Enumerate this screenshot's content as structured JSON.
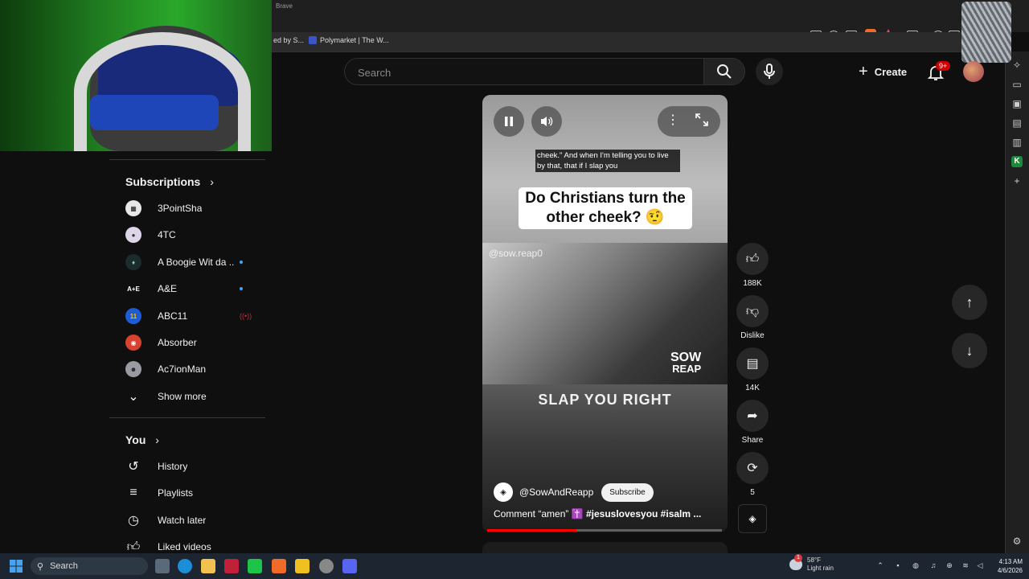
{
  "browser": {
    "app_name": "Brave",
    "bookmarks": [
      "ed by S...",
      "Polymarket | The W..."
    ]
  },
  "sidebar": {
    "subscriptions_title": "Subscriptions",
    "subscriptions": [
      {
        "name": "3PointSha",
        "dot": false
      },
      {
        "name": "4TC",
        "dot": false
      },
      {
        "name": "A Boogie Wit da ...",
        "dot": true
      },
      {
        "name": "A&E",
        "dot": true
      },
      {
        "name": "ABC11",
        "dot": false,
        "live": true
      },
      {
        "name": "Absorber",
        "dot": false
      },
      {
        "name": "Ac7ionMan",
        "dot": false
      }
    ],
    "show_more": "Show more",
    "you_title": "You",
    "you_items": [
      "History",
      "Playlists",
      "Watch later",
      "Liked videos"
    ]
  },
  "header": {
    "search_placeholder": "Search",
    "create_label": "Create",
    "notification_count": "9+"
  },
  "short": {
    "caption": "cheek.\" And when I'm telling you to live by that, that if I slap you",
    "question": "Do Christians turn the other cheek? 🤨",
    "watermark_handle": "@sow.reap0",
    "logo_line1": "SOW",
    "logo_line2": "REAP",
    "overlay_text": "SLAP YOU RIGHT",
    "channel": "@SowAndReapp",
    "subscribe_label": "Subscribe",
    "description_plain": "Comment “amen” ✝️ ",
    "description_tags": "#jesuslovesyou #isalm ...",
    "progress_percent": 38
  },
  "actions": {
    "likes": "188K",
    "dislike_label": "Dislike",
    "comments": "14K",
    "share_label": "Share",
    "remix_count": "5"
  },
  "taskbar": {
    "search_label": "Search",
    "weather_temp": "58°F",
    "weather_desc": "Light rain",
    "weather_badge": "1",
    "time": "4:13 AM",
    "date": "4/6/2026"
  },
  "colors": {
    "accent_red": "#ff0000",
    "subscribe_bg": "#f1f1f1",
    "badge_blue": "#3ea6ff"
  }
}
